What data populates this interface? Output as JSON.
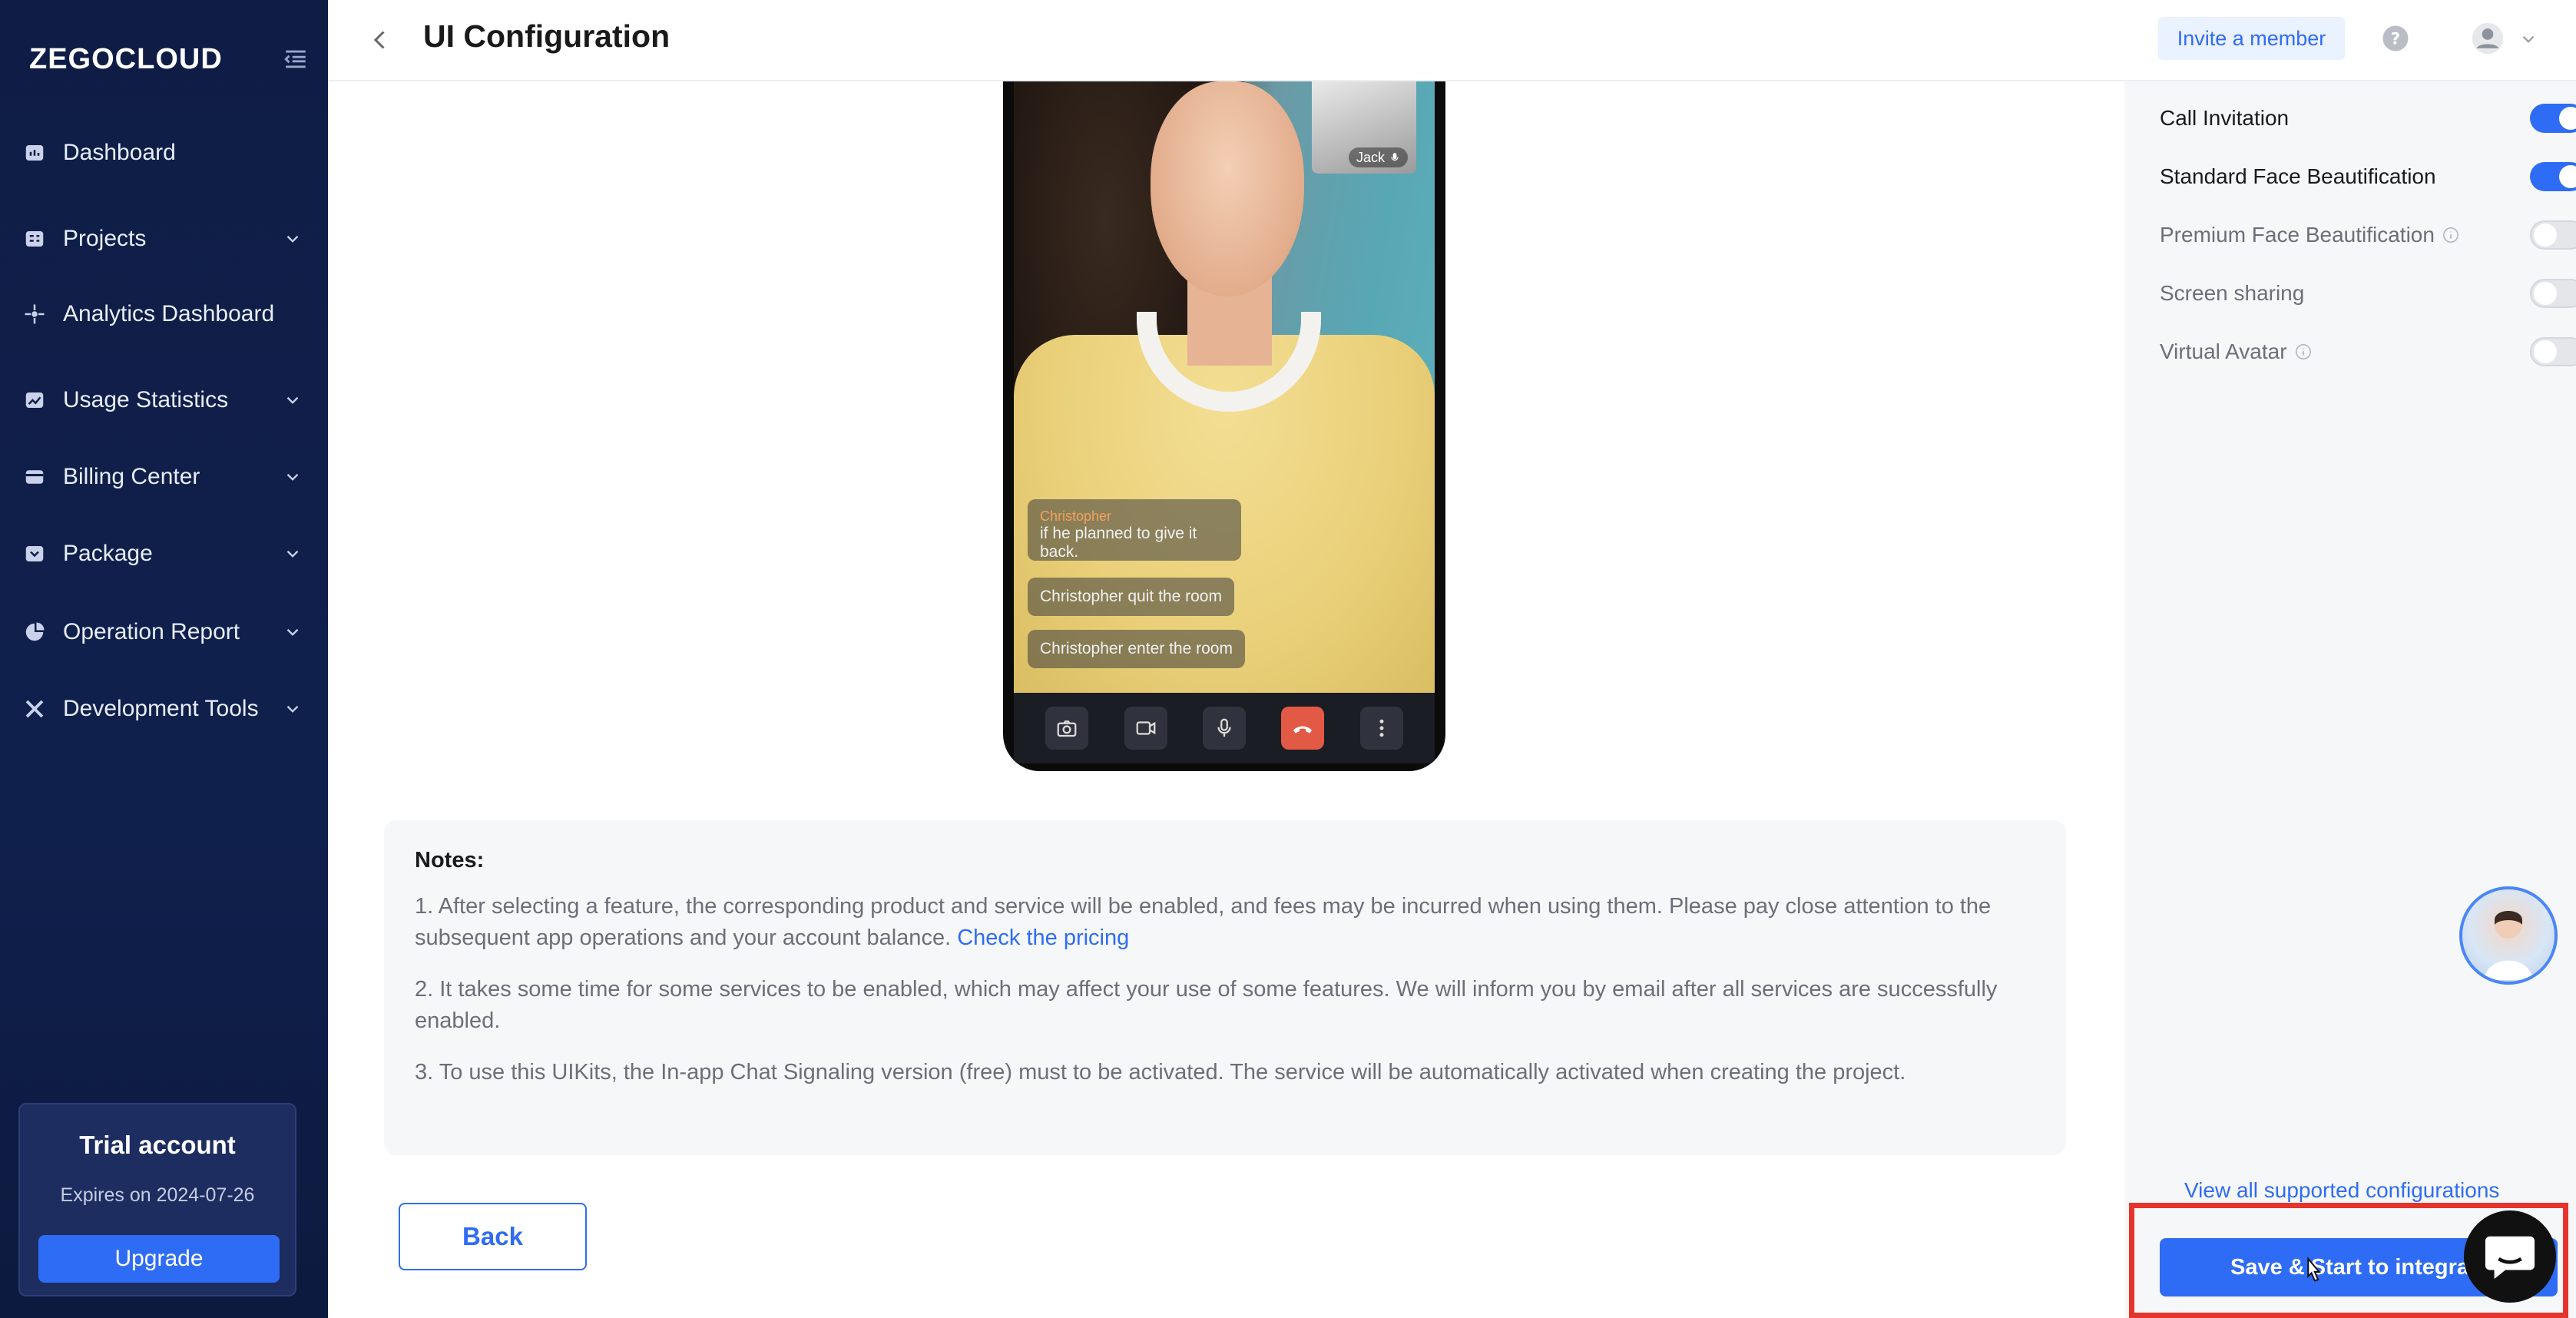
{
  "brand": {
    "logo": "ZEGOCLOUD"
  },
  "sidebar": {
    "items": [
      {
        "label": "Dashboard",
        "icon": "dashboard-icon",
        "has_chevron": false
      },
      {
        "label": "Projects",
        "icon": "projects-icon",
        "has_chevron": true
      },
      {
        "label": "Analytics Dashboard",
        "icon": "analytics-icon",
        "has_chevron": false
      },
      {
        "label": "Usage Statistics",
        "icon": "usage-icon",
        "has_chevron": true
      },
      {
        "label": "Billing Center",
        "icon": "billing-icon",
        "has_chevron": true
      },
      {
        "label": "Package",
        "icon": "package-icon",
        "has_chevron": true
      },
      {
        "label": "Operation Report",
        "icon": "report-icon",
        "has_chevron": true
      },
      {
        "label": "Development Tools",
        "icon": "tools-icon",
        "has_chevron": true
      }
    ],
    "trial": {
      "title": "Trial account",
      "expires": "Expires on 2024-07-26",
      "upgrade_label": "Upgrade"
    }
  },
  "header": {
    "title": "UI Configuration",
    "invite_label": "Invite a member"
  },
  "preview": {
    "pip_name": "Jack",
    "messages": [
      {
        "name": "Christopher",
        "text": "if he planned to give it back."
      },
      {
        "text": "Christopher quit the room"
      },
      {
        "text": "Christopher enter the room"
      }
    ]
  },
  "notes": {
    "title": "Notes:",
    "note1": "1. After selecting a feature, the corresponding product and service will be enabled, and fees may be incurred when using them. Please pay close attention to the subsequent app operations and your account balance.",
    "note1_link": "Check the pricing",
    "note2": "2. It takes some time for some services to be enabled, which may affect your use of some features. We will inform you by email after all services are successfully enabled.",
    "note3": "3. To use this UIKits, the In-app Chat Signaling version (free) must to be activated. The service will be automatically activated when creating the project."
  },
  "back_label": "Back",
  "features": [
    {
      "label": "Call Invitation",
      "enabled": true,
      "info": false
    },
    {
      "label": "Standard Face Beautification",
      "enabled": true,
      "info": false
    },
    {
      "label": "Premium Face Beautification",
      "enabled": false,
      "info": true
    },
    {
      "label": "Screen sharing",
      "enabled": false,
      "info": false
    },
    {
      "label": "Virtual Avatar",
      "enabled": false,
      "info": true
    }
  ],
  "view_all_label": "View all supported configurations",
  "save_label": "Save & Start to integrate",
  "colors": {
    "accent": "#2f6cf5",
    "sidebar_bg": "#0f1d45",
    "highlight": "#e5342b",
    "hangup": "#e25a45"
  }
}
